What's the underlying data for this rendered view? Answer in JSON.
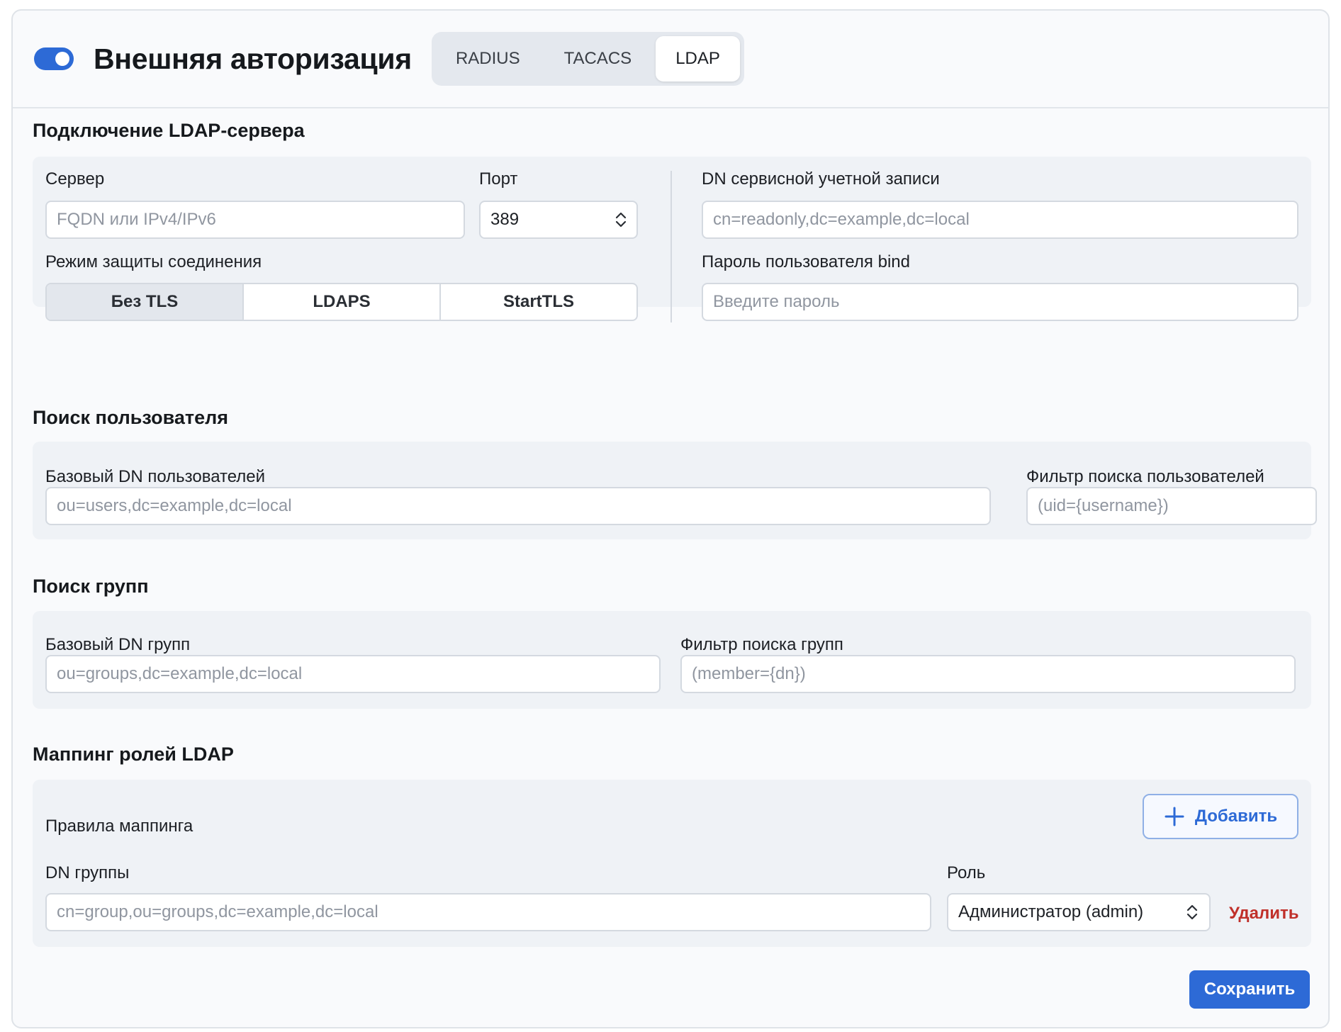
{
  "header": {
    "title": "Внешняя авторизация",
    "toggle_on": true,
    "tabs": [
      {
        "label": "RADIUS",
        "active": false
      },
      {
        "label": "TACACS",
        "active": false
      },
      {
        "label": "LDAP",
        "active": true
      }
    ]
  },
  "connection": {
    "title": "Подключение LDAP-сервера",
    "server_label": "Сервер",
    "server_placeholder": "FQDN или IPv4/IPv6",
    "port_label": "Порт",
    "port_value": "389",
    "security_label": "Режим защиты соединения",
    "security_options": [
      "Без TLS",
      "LDAPS",
      "StartTLS"
    ],
    "security_selected": "Без TLS",
    "bind_dn_label": "DN сервисной учетной записи",
    "bind_dn_placeholder": "cn=readonly,dc=example,dc=local",
    "bind_password_label": "Пароль пользователя bind",
    "bind_password_placeholder": "Введите пароль"
  },
  "user_search": {
    "title": "Поиск пользователя",
    "base_dn_label": "Базовый DN пользователей",
    "base_dn_placeholder": "ou=users,dc=example,dc=local",
    "filter_label": "Фильтр поиска пользователей",
    "filter_placeholder": "(uid={username})"
  },
  "group_search": {
    "title": "Поиск групп",
    "base_dn_label": "Базовый DN групп",
    "base_dn_placeholder": "ou=groups,dc=example,dc=local",
    "filter_label": "Фильтр поиска групп",
    "filter_placeholder": "(member={dn})"
  },
  "role_mapping": {
    "title": "Маппинг ролей LDAP",
    "rules_label": "Правила маппинга",
    "add_label": "Добавить",
    "group_dn_label": "DN группы",
    "group_dn_placeholder": "cn=group,ou=groups,dc=example,dc=local",
    "role_label": "Роль",
    "role_value": "Администратор (admin)",
    "delete_label": "Удалить"
  },
  "footer": {
    "save_label": "Сохранить"
  },
  "colors": {
    "accent": "#2d6ad6",
    "danger": "#c0302a",
    "panel": "#eff2f6",
    "page": "#f9fafc"
  }
}
